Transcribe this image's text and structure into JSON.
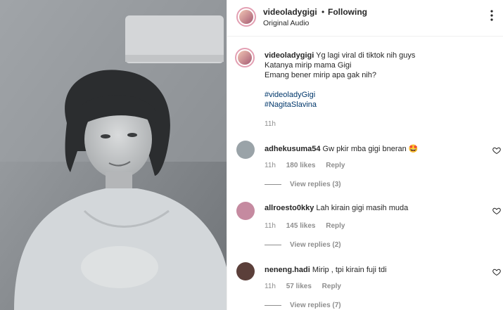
{
  "post": {
    "username": "videoladygigi",
    "separator": "•",
    "follow_status": "Following",
    "audio": "Original Audio",
    "caption": {
      "username": "videoladygigi",
      "lines": [
        "Yg lagi viral di tiktok nih guys",
        "Katanya mirip mama Gigi",
        "Emang bener mirip apa gak nih?"
      ],
      "hashtags": [
        "#videoladyGigi",
        "#NagitaSlavina"
      ],
      "time": "11h"
    }
  },
  "comments": [
    {
      "username": "adhekusuma54",
      "text": "Gw pkir mba gigi bneran 🤩",
      "time": "11h",
      "likes": "180 likes",
      "reply": "Reply",
      "view_replies": "View replies (3)",
      "avatar_color": "#9aa3a8"
    },
    {
      "username": "allroesto0kky",
      "text": "Lah kirain gigi masih muda",
      "time": "11h",
      "likes": "145 likes",
      "reply": "Reply",
      "view_replies": "View replies (2)",
      "avatar_color": "#c58aa0"
    },
    {
      "username": "neneng.hadi",
      "text": "Mirip , tpi kirain fuji tdi",
      "time": "11h",
      "likes": "57 likes",
      "reply": "Reply",
      "view_replies": "View replies (7)",
      "avatar_color": "#5b3f3a"
    }
  ],
  "icons": {
    "more": "more-options-icon",
    "like": "heart-icon"
  },
  "colors": {
    "link": "#00376b",
    "muted": "#8e8e8e",
    "text": "#262626",
    "story_ring": "#e3a0b3"
  }
}
